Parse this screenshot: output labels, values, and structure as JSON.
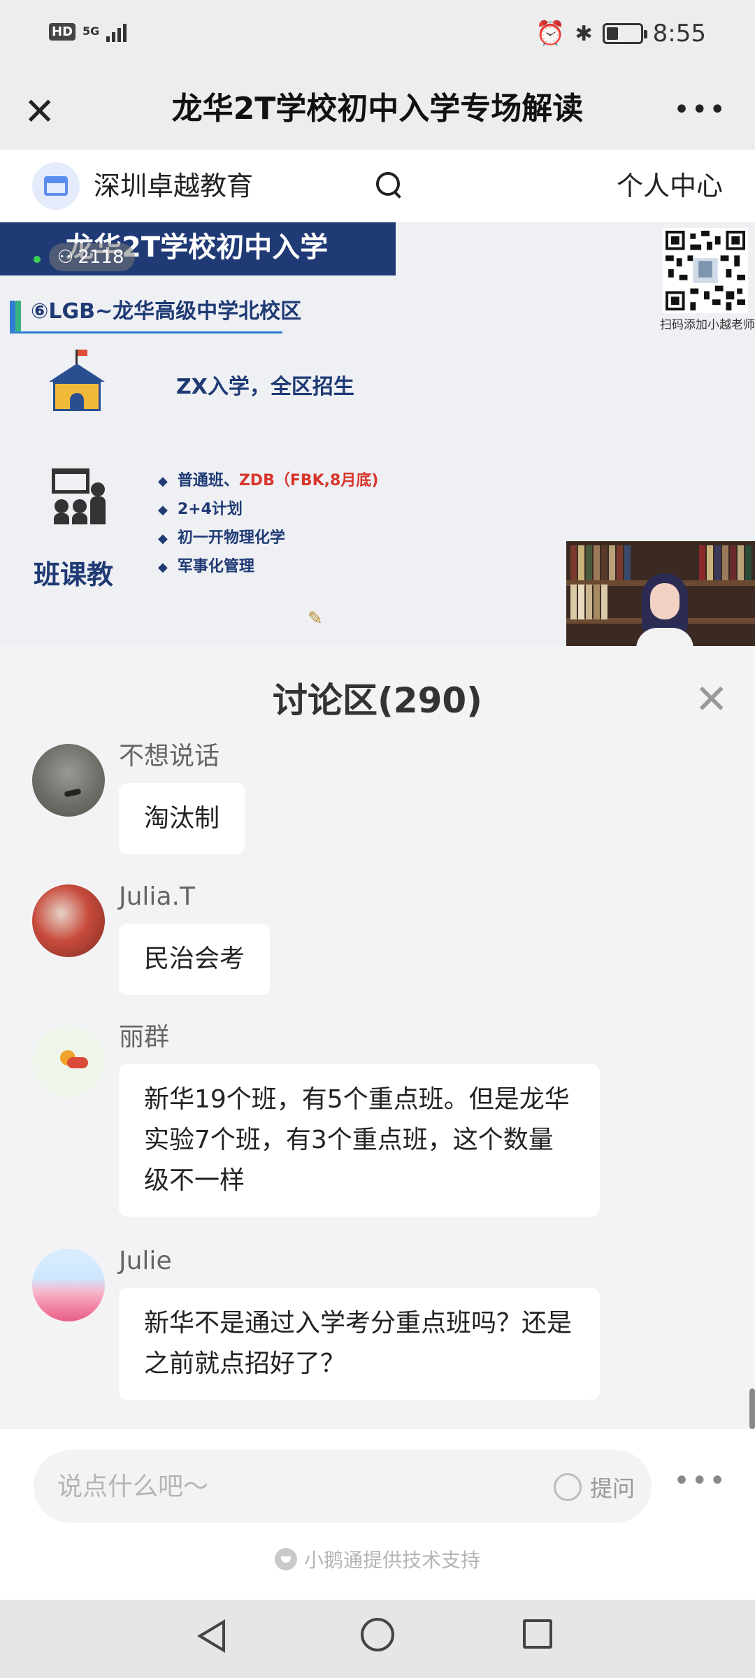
{
  "status_bar": {
    "hd": "HD",
    "network": "5G",
    "time": "8:55",
    "battery_level": 0.35
  },
  "title_bar": {
    "title": "龙华2T学校初中入学专场解读"
  },
  "shop_bar": {
    "name": "深圳卓越教育",
    "user_center": "个人中心"
  },
  "video": {
    "viewer_count": "2118",
    "slide": {
      "title": "龙华2T学校初中入学",
      "campus": "⑥LGB~龙华高级中学北校区",
      "admission": "ZX入学，全区招生",
      "class_label": "班课教",
      "bullet1_prefix": "普通班、",
      "bullet1_highlight": "ZDB（FBK,8月底)",
      "bullet2": "2+4计划",
      "bullet3": "初一开物理化学",
      "bullet4": "军事化管理",
      "qr_caption": "扫码添加小越老师"
    }
  },
  "discussion": {
    "title": "讨论区(290)",
    "messages": [
      {
        "user": "不想说话",
        "text": "淘汰制"
      },
      {
        "user": "Julia.T",
        "text": "民治会考"
      },
      {
        "user": "丽群",
        "text": "新华19个班，有5个重点班。但是龙华实验7个班，有3个重点班，这个数量级不一样"
      },
      {
        "user": "Julie",
        "text": "新华不是通过入学考分重点班吗？还是之前就点招好了？"
      }
    ]
  },
  "input_bar": {
    "value": "",
    "placeholder": "说点什么吧～",
    "ask_label": "提问",
    "powered_by": "小鹅通提供技术支持"
  },
  "colors": {
    "slide_navy": "#1f3a74",
    "highlight_red": "#d9352b",
    "shop_blue": "#5b8def"
  }
}
